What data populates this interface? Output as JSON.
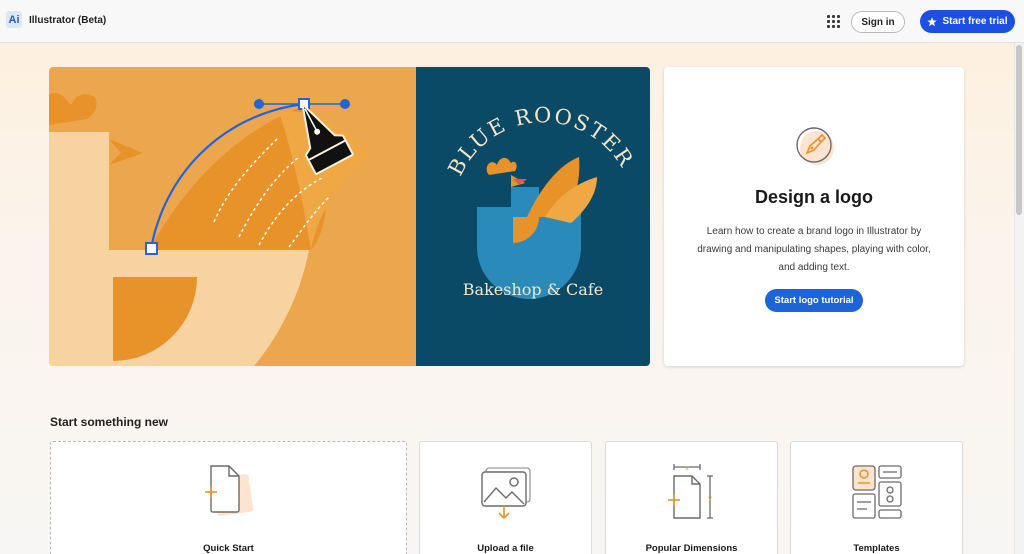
{
  "header": {
    "app_icon": "Ai",
    "app_title": "Illustrator (Beta)",
    "apps_icon": "apps-grid-icon",
    "signin_label": "Sign in",
    "trial_label": "Start free trial",
    "trial_icon": "star-icon",
    "accent": "#1d4fe0"
  },
  "hero": {
    "art": {
      "brand_line": "BLUE ROOSTER",
      "tagline": "Bakeshop & Cafe",
      "colors": {
        "orange": "#eca74e",
        "teal": "#0a4a67",
        "blue": "#1f66d6"
      }
    },
    "card": {
      "icon": "pen-tool-icon",
      "title": "Design a logo",
      "description": "Learn how to create a brand logo in Illustrator by drawing and manipulating shapes, playing with color, and adding text.",
      "button_label": "Start logo tutorial"
    }
  },
  "start_new": {
    "title": "Start something new",
    "tiles": [
      {
        "label": "Quick Start",
        "icon": "new-document-icon"
      },
      {
        "label": "Upload a file",
        "icon": "upload-image-icon"
      },
      {
        "label": "Popular Dimensions",
        "icon": "dimensions-icon"
      },
      {
        "label": "Templates",
        "icon": "templates-icon"
      }
    ]
  }
}
